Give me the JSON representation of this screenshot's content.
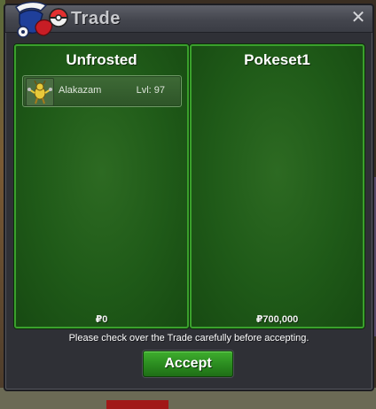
{
  "window": {
    "title": "Trade",
    "close_icon": "close-icon",
    "close_glyph": "✕"
  },
  "left_panel": {
    "player_name": "Unfrosted",
    "pokemon": [
      {
        "name": "Alakazam",
        "level": "Lvl: 97"
      }
    ],
    "money": "₽0"
  },
  "right_panel": {
    "player_name": "Pokeset1",
    "pokemon": [],
    "money": "₽700,000"
  },
  "footer": {
    "notice": "Please check over the Trade carefully before accepting.",
    "accept_label": "Accept"
  },
  "colors": {
    "panel_border": "#3aa02c",
    "panel_fill": "#1f5a18",
    "accept_button": "#2a8a1f",
    "window_bg": "#2f3036"
  }
}
